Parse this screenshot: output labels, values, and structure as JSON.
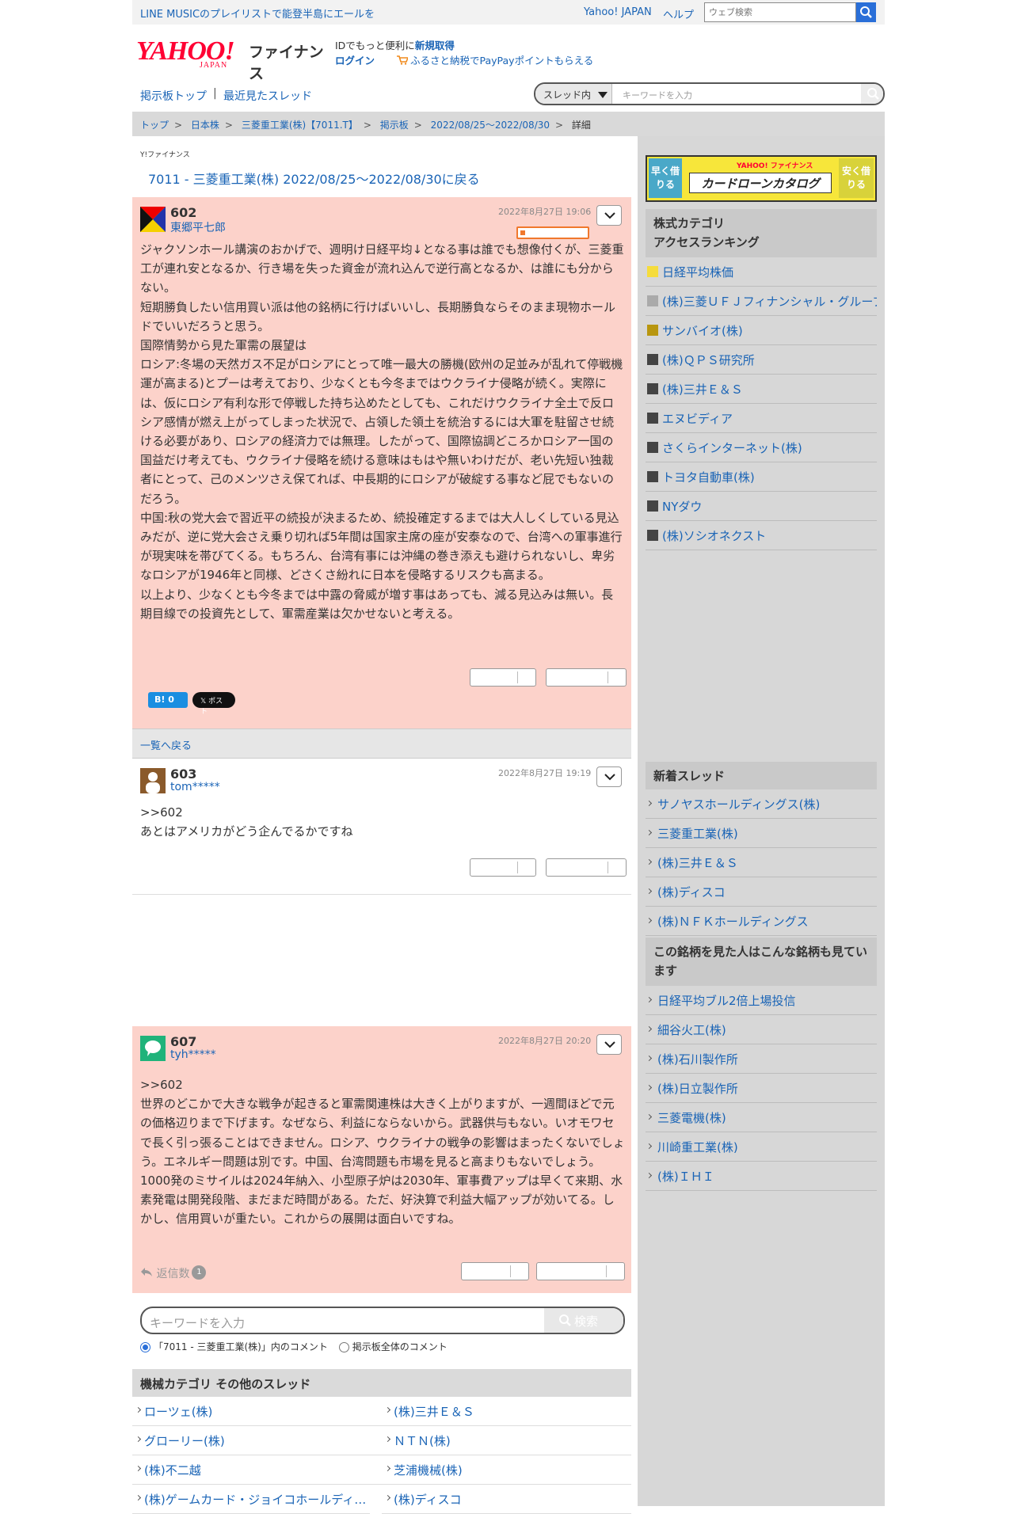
{
  "header": {
    "promo": "LINE MUSICのプレイリストで能登半島にエールを",
    "yahoo_link": "Yahoo! JAPAN",
    "help_link": "ヘルプ",
    "web_search_placeholder": "ウェブ検索",
    "logo_yahoo": "YAHOO!",
    "logo_japan": "JAPAN",
    "logo_finance": "ファイナンス",
    "id_text": "IDでもっと便利に",
    "id_register": "新規取得",
    "login": "ログイン",
    "furusato": "ふるさと納税でPayPayポイントもらえる"
  },
  "nav": {
    "board_top": "掲示板トップ",
    "separator": "|",
    "recent_threads": "最近見たスレッド",
    "search_scope": "スレッド内",
    "search_placeholder": "キーワードを入力"
  },
  "breadcrumb": [
    "トップ",
    "日本株",
    "三菱重工業(株)【7011.T】",
    "掲示板",
    "2022/08/25〜2022/08/30",
    "詳細"
  ],
  "main": {
    "yahoo_finance_small": "Y!ファイナンス",
    "back_title": "7011 - 三菱重工業(株) 2022/08/25〜2022/08/30に戻る",
    "hatena_label": "B! 0",
    "x_label": "𝕏 ポスト",
    "back_to_list": "一覧へ戻る",
    "replies_label": "返信数",
    "replies_count": "1",
    "keyword_placeholder": "キーワードを入力",
    "keyword_button": "検索",
    "radio_thread": "「7011 - 三菱重工業(株)」内のコメント",
    "radio_all": "掲示板全体のコメント",
    "category_header": "機械カテゴリ  その他のスレッド"
  },
  "posts": [
    {
      "number": "602",
      "user": "東郷平七郎",
      "date": "2022年8月27日 19:06",
      "body": "ジャクソンホール講演のおかげで、週明け日経平均↓となる事は誰でも想像付くが、三菱重工が連れ安となるか、行き場を失った資金が流れ込んで逆行高となるか、は誰にも分からない。\n短期勝負したい信用買い派は他の銘柄に行けばいいし、長期勝負ならそのまま現物ホールドでいいだろうと思う。\n国際情勢から見た軍需の展望は\nロシア:冬場の天然ガス不足がロシアにとって唯一最大の勝機(欧州の足並みが乱れて停戦機運が高まる)とプーは考えており、少なくとも今冬まではウクライナ侵略が続く。実際には、仮にロシア有利な形で停戦した持ち込めたとしても、これだけウクライナ全土で反ロシア感情が燃え上がってしまった状況で、占領した領土を統治するには大軍を駐留させ続ける必要があり、ロシアの経済力では無理。したがって、国際協調どころかロシア一国の国益だけ考えても、ウクライナ侵略を続ける意味はもはや無いわけだが、老い先短い独裁者にとって、己のメンツさえ保てれば、中長期的にロシアが破綻する事など屁でもないのだろう。\n中国:秋の党大会で習近平の続投が決まるため、続投確定するまでは大人しくしている見込みだが、逆に党大会さえ乗り切れば5年間は国家主席の座が安泰なので、台湾への軍事進行が現実味を帯びてくる。もちろん、台湾有事には沖縄の巻き添えも避けられないし、卑劣なロシアが1946年と同様、どさくさ紛れに日本を侵略するリスクも高まる。\n以上より、少なくとも今冬までは中露の脅威が増す事はあっても、減る見込みは無い。長期目線での投資先として、軍需産業は欠かせないと考える。"
    },
    {
      "number": "603",
      "user": "tom*****",
      "date": "2022年8月27日 19:19",
      "body": ">>602\nあとはアメリカがどう企んでるかですね"
    },
    {
      "number": "607",
      "user": "tyh*****",
      "date": "2022年8月27日 20:20",
      "body": ">>602\n世界のどこかで大きな戦争が起きると軍需関連株は大きく上がりますが、一週間ほどで元の価格辺りまで下げます。なぜなら、利益にならないから。武器供与もない。いオモワセで長く引っ張ることはできません。ロシア、ウクライナの戦争の影響はまったくないでしょう。エネルギー問題は別です。中国、台湾問題も市場を見ると高まりもないでしょう。1000発のミサイルは2024年納入、小型原子炉は2030年、軍事費アップは早くて来期、水素発電は開発段階、まだまだ時間がある。ただ、好決算で利益大幅アップが効いてる。しかし、信用買いが重たい。これからの展開は面白いですね。"
    }
  ],
  "other_threads": [
    [
      "ローツェ(株)",
      "(株)三井Ｅ＆Ｓ"
    ],
    [
      "グローリー(株)",
      "ＮＴＮ(株)"
    ],
    [
      "(株)不二越",
      "芝浦機械(株)"
    ],
    [
      "(株)ゲームカード・ジョイコホールディングス",
      "(株)ディスコ"
    ]
  ],
  "sidebar": {
    "ad": {
      "left": "早く借りる",
      "center": "カードローンカタログ",
      "brand": "YAHOO! ファイナンス",
      "right": "安く借りる"
    },
    "ranking_header": "株式カテゴリ\nアクセスランキング",
    "ranking": [
      {
        "label": "日経平均株価",
        "color": "#f5dc3c"
      },
      {
        "label": "(株)三菱ＵＦＪフィナンシャル・グループ",
        "color": "#aaaaaa"
      },
      {
        "label": "サンバイオ(株)",
        "color": "#b8960f"
      },
      {
        "label": "(株)ＱＰＳ研究所",
        "color": "#444444"
      },
      {
        "label": "(株)三井Ｅ＆Ｓ",
        "color": "#444444"
      },
      {
        "label": "エヌビディア",
        "color": "#444444"
      },
      {
        "label": "さくらインターネット(株)",
        "color": "#444444"
      },
      {
        "label": "トヨタ自動車(株)",
        "color": "#444444"
      },
      {
        "label": "NYダウ",
        "color": "#444444"
      },
      {
        "label": "(株)ソシオネクスト",
        "color": "#444444"
      }
    ],
    "new_threads_header": "新着スレッド",
    "new_threads": [
      "サノヤスホールディングス(株)",
      "三菱重工業(株)",
      "(株)三井Ｅ＆Ｓ",
      "(株)ディスコ",
      "(株)ＮＦＫホールディングス"
    ],
    "also_viewed_header": "この銘柄を見た人はこんな銘柄も見ています",
    "also_viewed": [
      "日経平均ブル2倍上場投信",
      "細谷火工(株)",
      "(株)石川製作所",
      "(株)日立製作所",
      "三菱電機(株)",
      "川崎重工業(株)",
      "(株)ＩＨＩ"
    ]
  }
}
